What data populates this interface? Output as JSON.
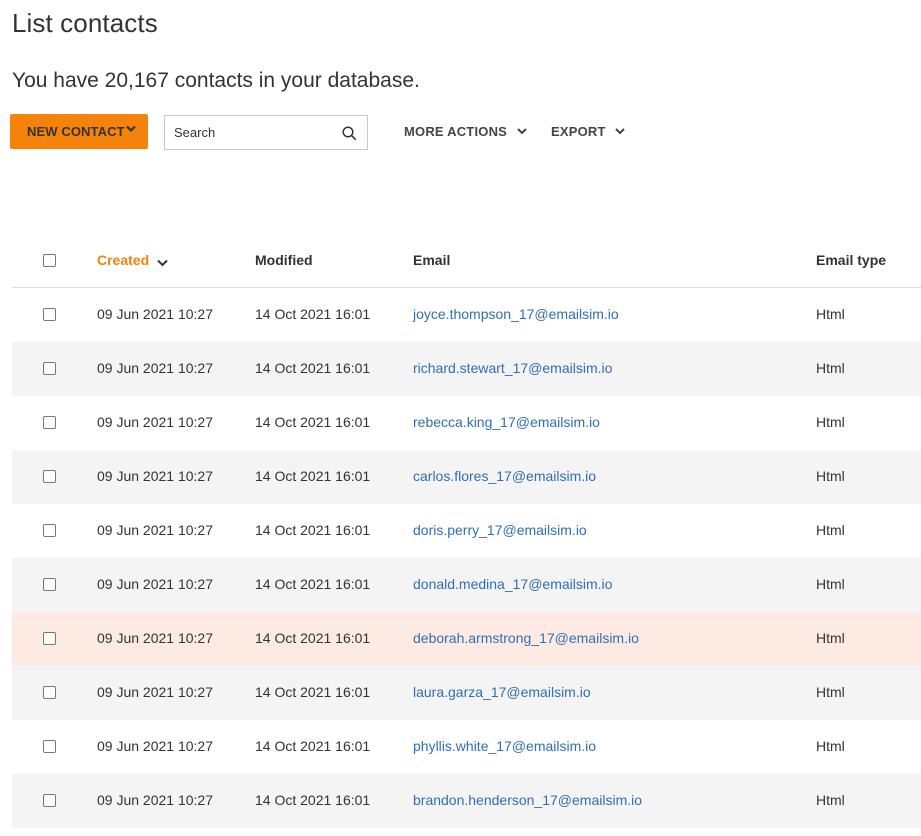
{
  "page": {
    "title": "List contacts",
    "summary": "You have 20,167 contacts in your database."
  },
  "toolbar": {
    "new_contact_label": "NEW CONTACT",
    "search_placeholder": "Search",
    "more_actions_label": "MORE ACTIONS",
    "export_label": "EXPORT"
  },
  "colors": {
    "accent": "#f5820b",
    "link": "#2f6fb5",
    "row_alt": "#f4f4f4",
    "row_highlight": "#fdeae2"
  },
  "table": {
    "columns": [
      "Created",
      "Modified",
      "Email",
      "Email type"
    ],
    "sorted_column": "Created",
    "rows": [
      {
        "created": "09 Jun 2021 10:27",
        "modified": "14 Oct 2021 16:01",
        "email": "joyce.thompson_17@emailsim.io",
        "type": "Html"
      },
      {
        "created": "09 Jun 2021 10:27",
        "modified": "14 Oct 2021 16:01",
        "email": "richard.stewart_17@emailsim.io",
        "type": "Html"
      },
      {
        "created": "09 Jun 2021 10:27",
        "modified": "14 Oct 2021 16:01",
        "email": "rebecca.king_17@emailsim.io",
        "type": "Html"
      },
      {
        "created": "09 Jun 2021 10:27",
        "modified": "14 Oct 2021 16:01",
        "email": "carlos.flores_17@emailsim.io",
        "type": "Html"
      },
      {
        "created": "09 Jun 2021 10:27",
        "modified": "14 Oct 2021 16:01",
        "email": "doris.perry_17@emailsim.io",
        "type": "Html"
      },
      {
        "created": "09 Jun 2021 10:27",
        "modified": "14 Oct 2021 16:01",
        "email": "donald.medina_17@emailsim.io",
        "type": "Html"
      },
      {
        "created": "09 Jun 2021 10:27",
        "modified": "14 Oct 2021 16:01",
        "email": "deborah.armstrong_17@emailsim.io",
        "type": "Html"
      },
      {
        "created": "09 Jun 2021 10:27",
        "modified": "14 Oct 2021 16:01",
        "email": "laura.garza_17@emailsim.io",
        "type": "Html"
      },
      {
        "created": "09 Jun 2021 10:27",
        "modified": "14 Oct 2021 16:01",
        "email": "phyllis.white_17@emailsim.io",
        "type": "Html"
      },
      {
        "created": "09 Jun 2021 10:27",
        "modified": "14 Oct 2021 16:01",
        "email": "brandon.henderson_17@emailsim.io",
        "type": "Html"
      }
    ]
  }
}
